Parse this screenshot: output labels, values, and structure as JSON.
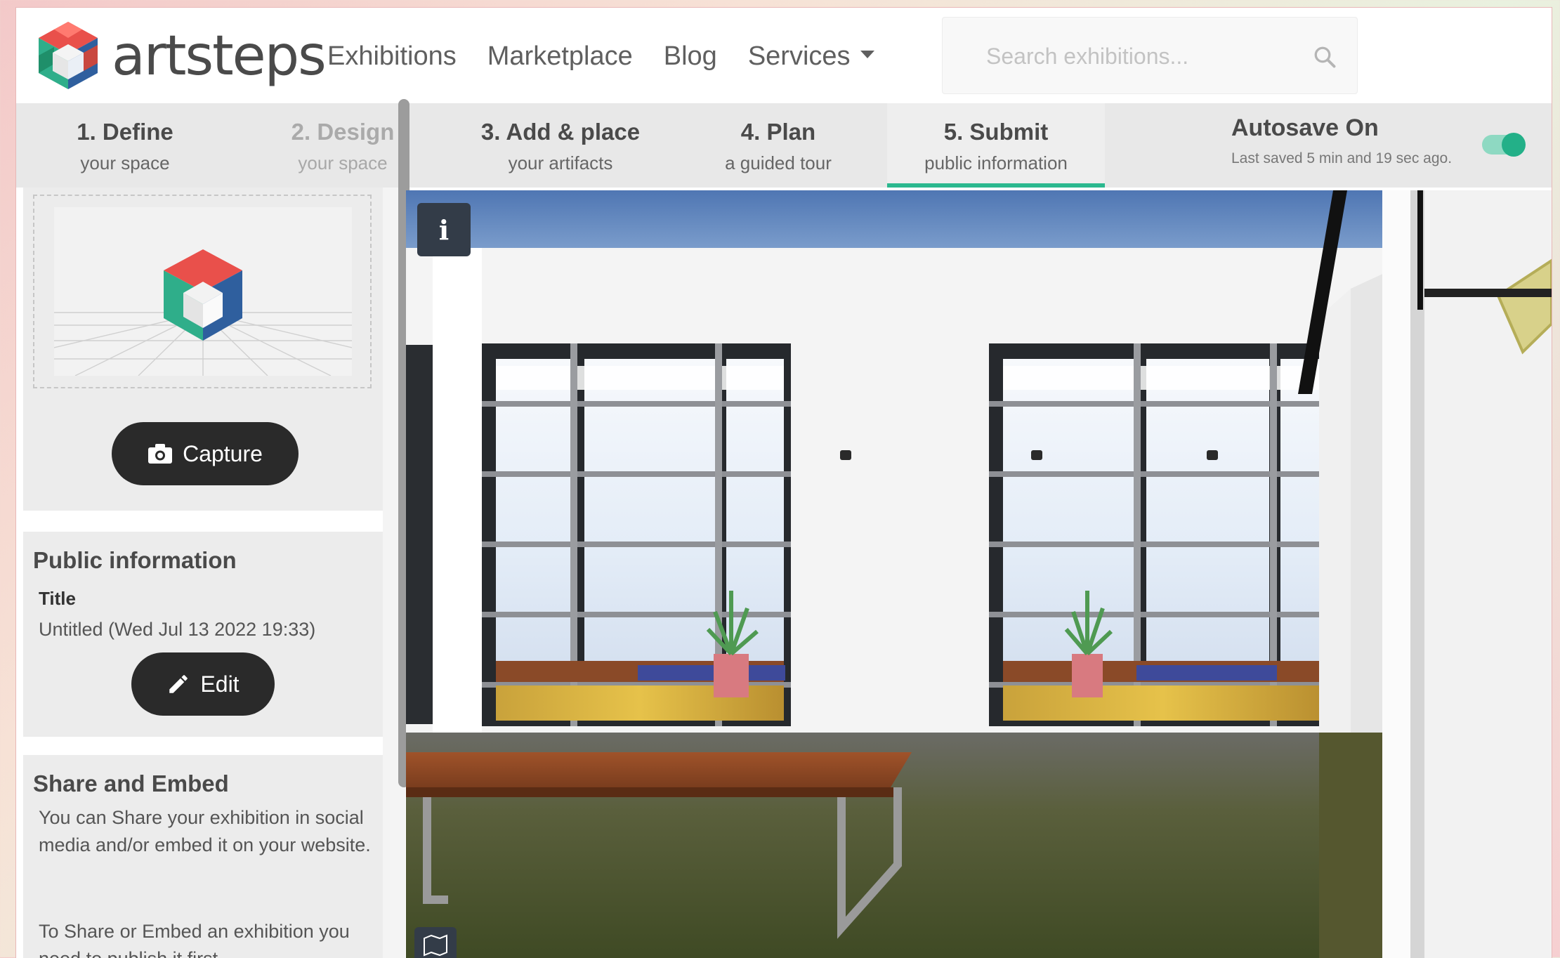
{
  "header": {
    "logo_text": "artsteps",
    "nav": [
      "Exhibitions",
      "Marketplace",
      "Blog",
      "Services"
    ],
    "search_placeholder": "Search exhibitions..."
  },
  "steps": [
    {
      "num": "1. Define",
      "sub": "your space",
      "state": "normal"
    },
    {
      "num": "2. Design",
      "sub": "your space",
      "state": "disabled"
    },
    {
      "num": "3. Add & place",
      "sub": "your artifacts",
      "state": "normal"
    },
    {
      "num": "4. Plan",
      "sub": "a guided tour",
      "state": "normal"
    },
    {
      "num": "5. Submit",
      "sub": "public information",
      "state": "active"
    }
  ],
  "autosave": {
    "title": "Autosave On",
    "last_saved": "Last saved 5 min and 19 sec ago.",
    "enabled": true
  },
  "sidebar": {
    "capture_label": "Capture",
    "public_info": {
      "heading": "Public information",
      "title_label": "Title",
      "title_value": "Untitled (Wed Jul 13 2022 19:33)",
      "edit_label": "Edit"
    },
    "share": {
      "heading": "Share and Embed",
      "text1": "You can Share your exhibition in social media and/or embed it on your website.",
      "text2": "To Share or Embed an exhibition you need to publish it first"
    }
  },
  "viewport": {
    "info_label": "i"
  },
  "colors": {
    "accent": "#2bb88f",
    "dark_button": "#2a2a2a",
    "step_bar": "#e8e8e8"
  }
}
